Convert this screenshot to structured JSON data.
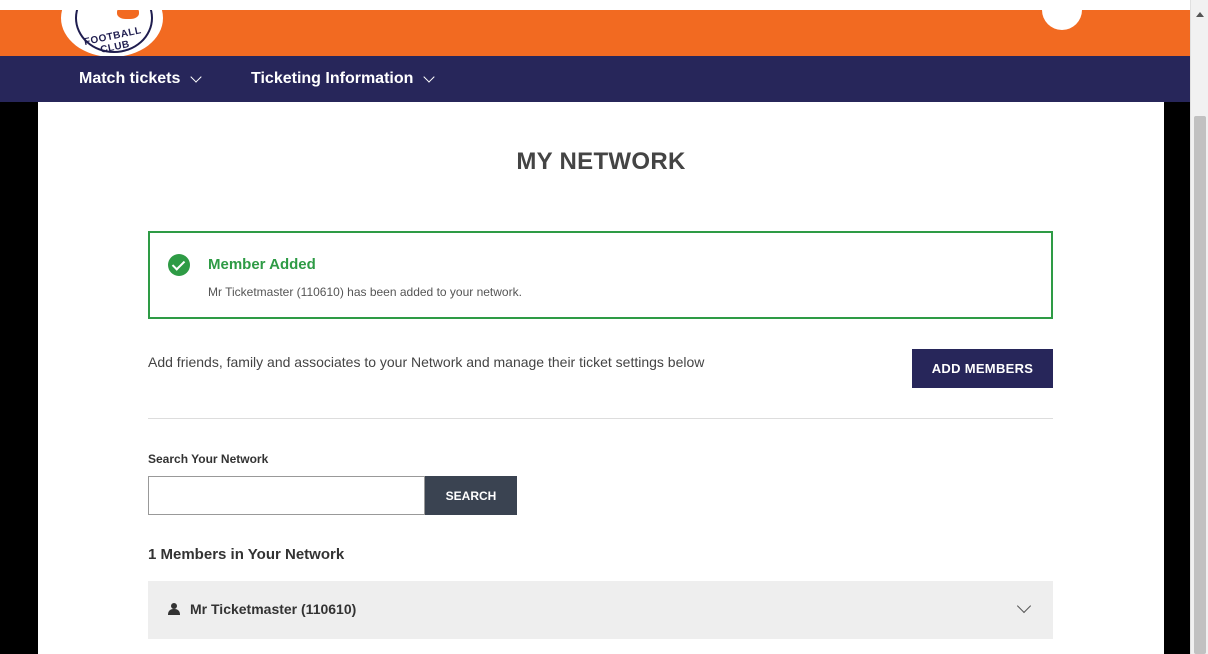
{
  "header": {
    "logo_text": "FOOTBALL CLUB"
  },
  "nav": {
    "items": [
      {
        "label": "Match tickets"
      },
      {
        "label": "Ticketing Information"
      }
    ]
  },
  "page": {
    "title": "MY NETWORK"
  },
  "alert": {
    "title": "Member Added",
    "message": "Mr Ticketmaster (110610) has been added to your network.",
    "color": "#2e9b45"
  },
  "intro": {
    "text": "Add friends, family and associates to your Network and manage their ticket settings below",
    "add_button_label": "ADD MEMBERS"
  },
  "search": {
    "label": "Search Your Network",
    "value": "",
    "placeholder": "",
    "button_label": "SEARCH"
  },
  "members": {
    "count_label": "1 Members in Your Network",
    "items": [
      {
        "name": "Mr Ticketmaster (110610)"
      }
    ]
  },
  "colors": {
    "brand_orange": "#f26a21",
    "brand_navy": "#27265a"
  }
}
